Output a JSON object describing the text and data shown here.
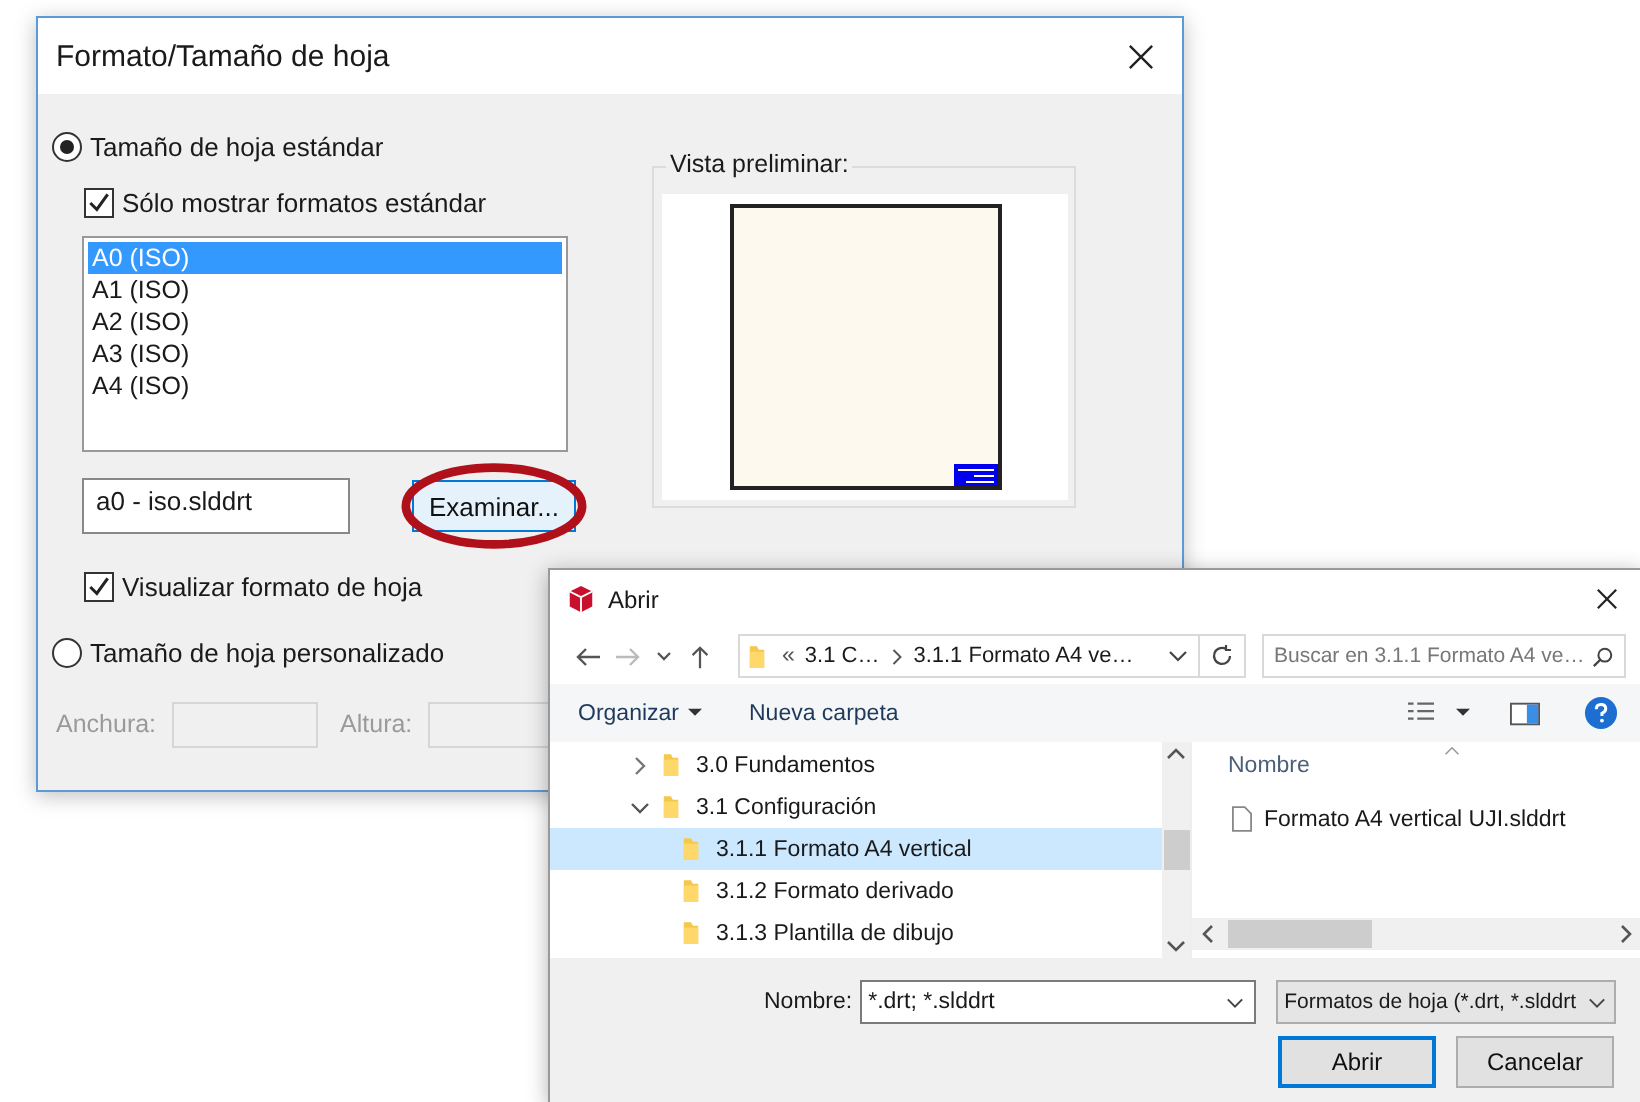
{
  "format_dialog": {
    "title": "Formato/Tamaño de hoja",
    "standard_radio": {
      "label": "Tamaño de hoja estándar",
      "selected": true
    },
    "only_standard_checkbox": {
      "label": "Sólo mostrar formatos estándar",
      "checked": true
    },
    "sheet_list": [
      {
        "label": "A0 (ISO)",
        "selected": true
      },
      {
        "label": "A1 (ISO)",
        "selected": false
      },
      {
        "label": "A2 (ISO)",
        "selected": false
      },
      {
        "label": "A3 (ISO)",
        "selected": false
      },
      {
        "label": "A4 (ISO)",
        "selected": false
      }
    ],
    "file_field": {
      "value": "a0 - iso.slddrt"
    },
    "browse_button": {
      "label": "Examinar...",
      "highlighted": true
    },
    "display_format_checkbox": {
      "label": "Visualizar formato de hoja",
      "checked": true
    },
    "custom_radio": {
      "label": "Tamaño de hoja personalizado",
      "selected": false
    },
    "width_field": {
      "label": "Anchura:",
      "disabled": true
    },
    "height_field": {
      "label": "Altura:",
      "disabled": true
    },
    "preview": {
      "title": "Vista preliminar:"
    }
  },
  "open_dialog": {
    "title": "Abrir",
    "address": {
      "overflow": "«",
      "crumbs": [
        "3.1 C…",
        "3.1.1 Formato A4 ve…"
      ]
    },
    "search": {
      "placeholder": "Buscar en 3.1.1 Formato A4 ve…"
    },
    "toolbar": {
      "organize": "Organizar",
      "new_folder": "Nueva carpeta"
    },
    "tree": [
      {
        "label": "3.0 Fundamentos",
        "expanded": false,
        "selected": false
      },
      {
        "label": "3.1 Configuración",
        "expanded": true,
        "selected": false,
        "children": [
          {
            "label": "3.1.1 Formato A4 vertical",
            "selected": true
          },
          {
            "label": "3.1.2 Formato derivado",
            "selected": false
          },
          {
            "label": "3.1.3 Plantilla de dibujo",
            "selected": false
          }
        ]
      }
    ],
    "files_header": "Nombre",
    "files": [
      {
        "name": "Formato A4 vertical UJI.slddrt"
      }
    ],
    "name_label": "Nombre:",
    "name_value": "*.drt; *.slddrt",
    "filter": "Formatos de hoja (*.drt, *.slddrt",
    "buttons": [
      {
        "label": "Abrir",
        "default": true
      },
      {
        "label": "Cancelar",
        "default": false
      }
    ]
  }
}
